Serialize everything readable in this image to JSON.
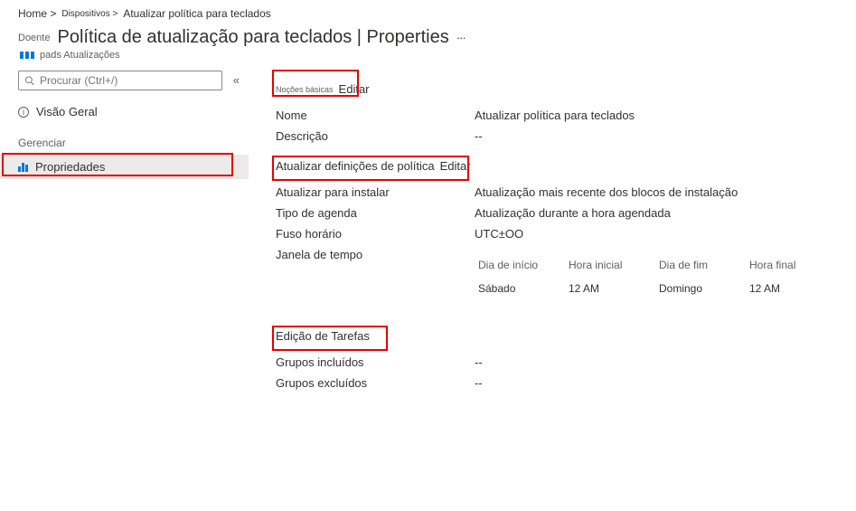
{
  "breadcrumb": {
    "home": "Home >",
    "devices": "Dispositivos >",
    "current": "Atualizar política para teclados"
  },
  "header": {
    "prelabel": "Doente",
    "title": "Política de atualização para teclados | Properties",
    "ellipsis": "···",
    "subtype": "pads Atualizações"
  },
  "sidebar": {
    "search_placeholder": "Procurar (Ctrl+/)",
    "collapse": "«",
    "overview": "Visão Geral",
    "manage_section": "Gerenciar",
    "properties": "Propriedades"
  },
  "sections": {
    "basics": {
      "title_small": "Noções básicas",
      "edit": "Editar",
      "name_label": "Nome",
      "name_value": "Atualizar política para teclados",
      "desc_label": "Descrição",
      "desc_value": "--"
    },
    "policy": {
      "title": "Atualizar definições de política",
      "edit": "Editar",
      "update_install_label": "Atualizar para instalar",
      "update_install_value": "Atualização mais recente dos blocos de instalação",
      "schedule_type_label": "Tipo de agenda",
      "schedule_type_value": "Atualização durante a hora agendada",
      "timezone_label": "Fuso horário",
      "timezone_value": "UTC±OO",
      "timewindow_label": "Janela de tempo"
    },
    "timewindow_table": {
      "head": {
        "start_day": "Dia de início",
        "start_time": "Hora inicial",
        "end_day": "Dia de fim",
        "end_time": "Hora final"
      },
      "row": {
        "start_day": "Sábado",
        "start_time": "12 AM",
        "end_day": "Domingo",
        "end_time": "12 AM"
      }
    },
    "assignments": {
      "title": "Edição de Tarefas",
      "included_label": "Grupos incluídos",
      "included_value": "--",
      "excluded_label": "Grupos excluídos",
      "excluded_value": "--"
    }
  }
}
